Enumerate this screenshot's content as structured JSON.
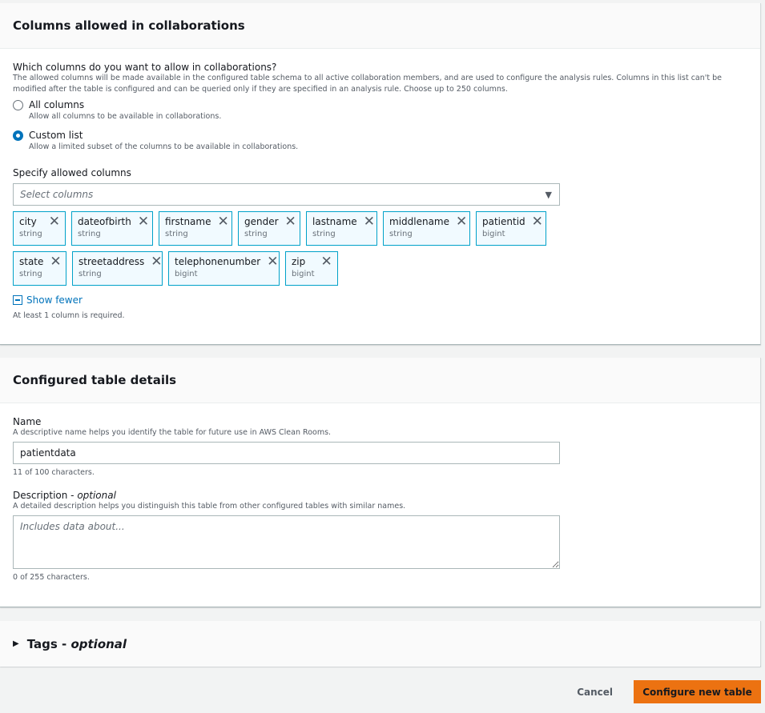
{
  "columns_panel": {
    "title": "Columns allowed in collaborations",
    "question": "Which columns do you want to allow in collaborations?",
    "question_desc": "The allowed columns will be made available in the configured table schema to all active collaboration members, and are used to configure the analysis rules. Columns in this list can't be modified after the table is configured and can be queried only if they are specified in an analysis rule. Choose up to 250 columns.",
    "options": [
      {
        "label": "All columns",
        "desc": "Allow all columns to be available in collaborations.",
        "selected": false
      },
      {
        "label": "Custom list",
        "desc": "Allow a limited subset of the columns to be available in collaborations.",
        "selected": true
      }
    ],
    "specify_label": "Specify allowed columns",
    "select_placeholder": "Select columns",
    "tokens": [
      {
        "name": "city",
        "type": "string"
      },
      {
        "name": "dateofbirth",
        "type": "string"
      },
      {
        "name": "firstname",
        "type": "string"
      },
      {
        "name": "gender",
        "type": "string"
      },
      {
        "name": "lastname",
        "type": "string"
      },
      {
        "name": "middlename",
        "type": "string"
      },
      {
        "name": "patientid",
        "type": "bigint"
      },
      {
        "name": "state",
        "type": "string"
      },
      {
        "name": "streetaddress",
        "type": "string"
      },
      {
        "name": "telephonenumber",
        "type": "bigint"
      },
      {
        "name": "zip",
        "type": "bigint"
      }
    ],
    "show_fewer": "Show fewer",
    "requirement": "At least 1 column is required."
  },
  "details_panel": {
    "title": "Configured table details",
    "name_label": "Name",
    "name_desc": "A descriptive name helps you identify the table for future use in AWS Clean Rooms.",
    "name_value": "patientdata",
    "name_count": "11 of 100 characters.",
    "description_label": "Description - ",
    "description_optional": "optional",
    "description_desc": "A detailed description helps you distinguish this table from other configured tables with similar names.",
    "description_placeholder": "Includes data about...",
    "description_count": "0 of 255 characters."
  },
  "tags_panel": {
    "title": "Tags - ",
    "optional": "optional"
  },
  "footer": {
    "cancel": "Cancel",
    "submit": "Configure new table"
  },
  "colors": {
    "primary_button": "#ec7211",
    "link": "#0073bb",
    "token_border": "#00a1c9"
  }
}
